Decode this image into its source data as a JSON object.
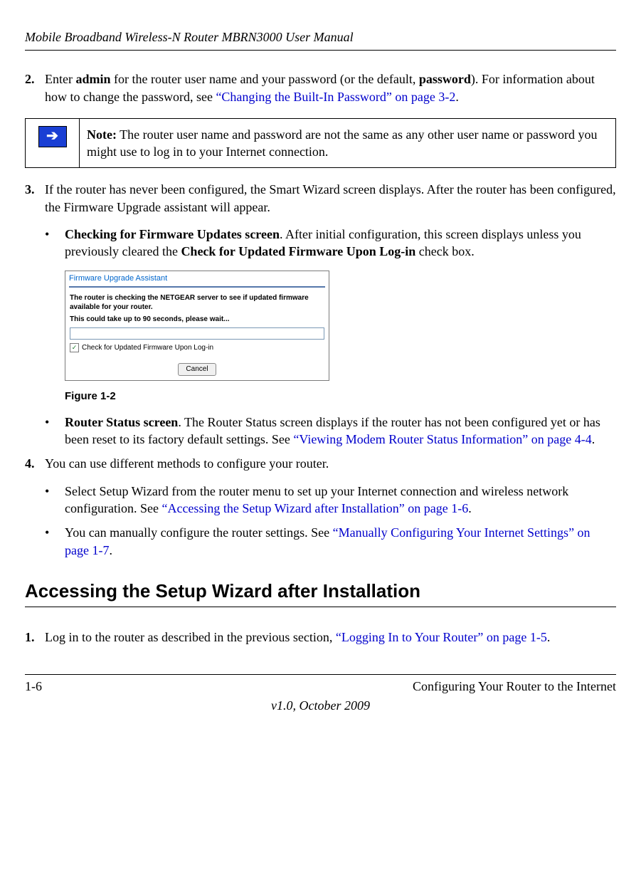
{
  "header": {
    "title": "Mobile Broadband Wireless-N Router MBRN3000 User Manual"
  },
  "steps": {
    "s2": {
      "num": "2.",
      "pre": "Enter ",
      "b1": "admin",
      "mid": " for the router user name and your password (or the default, ",
      "b2": "password",
      "post": "). For information about how to change the password, see ",
      "link": "“Changing the Built-In Password” on page 3-2",
      "end": "."
    },
    "s3": {
      "num": "3.",
      "text": "If the router has never been configured, the Smart Wizard screen displays. After the router has been configured, the Firmware Upgrade assistant will appear."
    },
    "s4": {
      "num": "4.",
      "text": "You can use different methods to configure your router."
    }
  },
  "note": {
    "label": "Note:",
    "text": " The router user name and password are not the same as any other user name or password you might use to log in to your Internet connection."
  },
  "bullets": {
    "b1": {
      "b": "Checking for Firmware Updates screen",
      "t1": ". After initial configuration, this screen displays unless you previously cleared the ",
      "b2": "Check for Updated Firmware Upon Log-in",
      "t2": " check box."
    },
    "b2": {
      "b": "Router Status screen",
      "t1": ". The Router Status screen displays if the router has not been configured yet or has been reset to its factory default settings. See ",
      "link": "“Viewing Modem Router Status Information” on page 4-4",
      "end": "."
    },
    "b3": {
      "t1": "Select Setup Wizard from the router menu to set up your Internet connection and wireless network configuration. See ",
      "link": "“Accessing the Setup Wizard after Installation” on page 1-6",
      "end": "."
    },
    "b4": {
      "t1": "You can manually configure the router settings. See ",
      "link": "“Manually Configuring Your Internet Settings” on page 1-7",
      "end": "."
    }
  },
  "figure": {
    "title": "Firmware Upgrade Assistant",
    "line1": "The router is checking the NETGEAR server to see if updated firmware available for your router.",
    "line2": "This could take up to 90 seconds, please wait...",
    "checkbox_label": "Check for Updated Firmware Upon Log-in",
    "cancel": "Cancel",
    "caption": "Figure 1-2"
  },
  "section": {
    "title": "Accessing the Setup Wizard after Installation"
  },
  "step_sec1": {
    "num": "1.",
    "t1": "Log in to the router as described in the previous section, ",
    "link": "“Logging In to Your Router” on page 1-5",
    "end": "."
  },
  "footer": {
    "page": "1-6",
    "chapter": "Configuring Your Router to the Internet",
    "version": "v1.0, October 2009"
  }
}
